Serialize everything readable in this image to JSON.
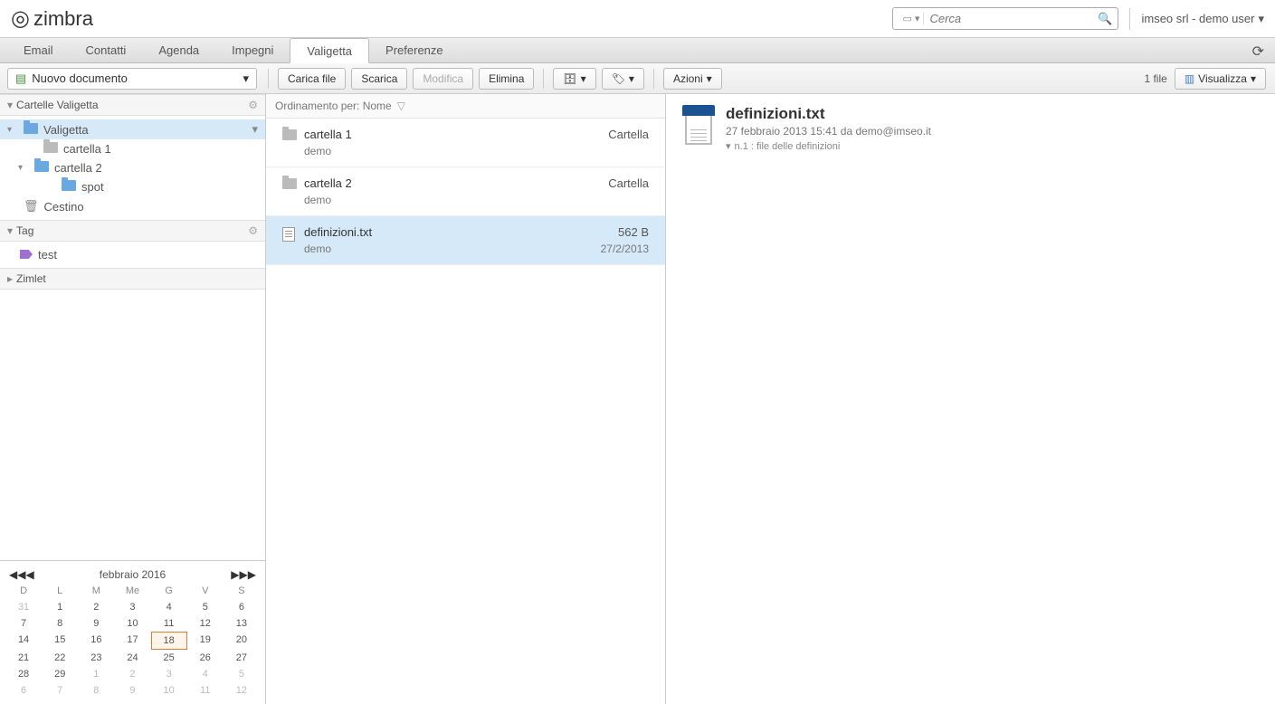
{
  "brand": "zimbra",
  "search": {
    "placeholder": "Cerca"
  },
  "user": "imseo srl - demo user",
  "tabs": [
    "Email",
    "Contatti",
    "Agenda",
    "Impegni",
    "Valigetta",
    "Preferenze"
  ],
  "active_tab": "Valigetta",
  "toolbar": {
    "new_doc": "Nuovo documento",
    "buttons": {
      "upload": "Carica file",
      "download": "Scarica",
      "edit": "Modifica",
      "delete": "Elimina",
      "actions": "Azioni"
    },
    "count": "1 file",
    "view": "Visualizza"
  },
  "sidebar": {
    "sections": {
      "folders": "Cartelle Valigetta",
      "tags": "Tag",
      "zimlets": "Zimlet"
    },
    "tree": {
      "root": "Valigetta",
      "c1": "cartella 1",
      "c2": "cartella 2",
      "spot": "spot",
      "trash": "Cestino"
    },
    "tag_item": "test"
  },
  "calendar": {
    "title": "febbraio 2016",
    "dow": [
      "D",
      "L",
      "M",
      "Me",
      "G",
      "V",
      "S"
    ],
    "weeks": [
      [
        {
          "d": "31",
          "o": true
        },
        {
          "d": "1"
        },
        {
          "d": "2"
        },
        {
          "d": "3"
        },
        {
          "d": "4"
        },
        {
          "d": "5"
        },
        {
          "d": "6"
        }
      ],
      [
        {
          "d": "7"
        },
        {
          "d": "8"
        },
        {
          "d": "9"
        },
        {
          "d": "10"
        },
        {
          "d": "11"
        },
        {
          "d": "12"
        },
        {
          "d": "13"
        }
      ],
      [
        {
          "d": "14"
        },
        {
          "d": "15"
        },
        {
          "d": "16"
        },
        {
          "d": "17"
        },
        {
          "d": "18",
          "today": true
        },
        {
          "d": "19"
        },
        {
          "d": "20"
        }
      ],
      [
        {
          "d": "21"
        },
        {
          "d": "22"
        },
        {
          "d": "23"
        },
        {
          "d": "24"
        },
        {
          "d": "25"
        },
        {
          "d": "26"
        },
        {
          "d": "27"
        }
      ],
      [
        {
          "d": "28"
        },
        {
          "d": "29"
        },
        {
          "d": "1",
          "o": true
        },
        {
          "d": "2",
          "o": true
        },
        {
          "d": "3",
          "o": true
        },
        {
          "d": "4",
          "o": true
        },
        {
          "d": "5",
          "o": true
        }
      ],
      [
        {
          "d": "6",
          "o": true
        },
        {
          "d": "7",
          "o": true
        },
        {
          "d": "8",
          "o": true
        },
        {
          "d": "9",
          "o": true
        },
        {
          "d": "10",
          "o": true
        },
        {
          "d": "11",
          "o": true
        },
        {
          "d": "12",
          "o": true
        }
      ]
    ]
  },
  "sort": {
    "label": "Ordinamento per: Nome"
  },
  "files": [
    {
      "name": "cartella 1",
      "owner": "demo",
      "type": "Cartella",
      "date": "",
      "folder": true
    },
    {
      "name": "cartella 2",
      "owner": "demo",
      "type": "Cartella",
      "date": "",
      "folder": true
    },
    {
      "name": "definizioni.txt",
      "owner": "demo",
      "type": "562 B",
      "date": "27/2/2013",
      "folder": false,
      "selected": true
    }
  ],
  "preview": {
    "title": "definizioni.txt",
    "meta": "27 febbraio 2013 15:41 da demo@imseo.it",
    "version": "n.1 : file delle definizioni"
  }
}
